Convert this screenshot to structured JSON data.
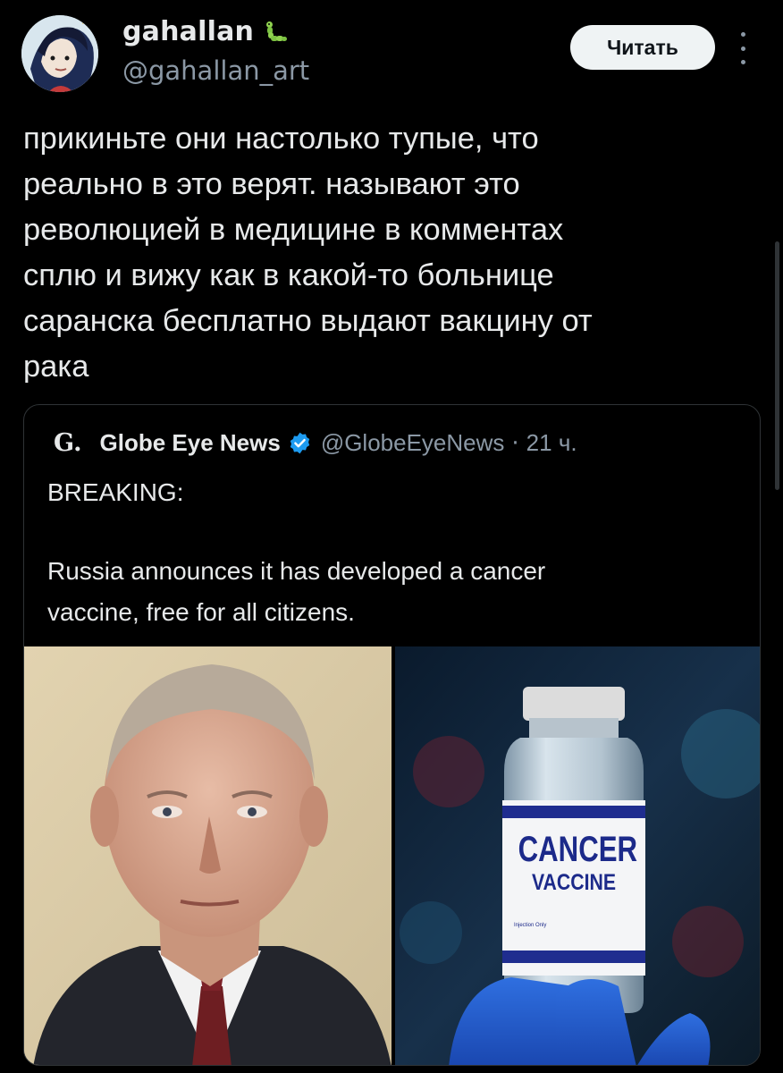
{
  "author": {
    "name": "gahallan",
    "handle": "@gahallan_art"
  },
  "header": {
    "follow_label": "Читать"
  },
  "post": {
    "text": "прикиньте они настолько тупые, что\nреально в это верят.  называют это\nреволюцией в медицине в комментах\nсплю и вижу как в какой-то больнице\nсаранска бесплатно  выдают вакцину от\nрака"
  },
  "quote": {
    "logo": "G.",
    "name": "Globe Eye News",
    "handle": "@GlobeEyeNews",
    "separator": "·",
    "time": "21 ч.",
    "breaking": "BREAKING:",
    "body": "Russia announces it has developed a cancer\nvaccine, free for all citizens.",
    "media_right": {
      "label_line1": "CANCER",
      "label_line2": "VACCINE",
      "label_small": "Injection Only"
    }
  },
  "colors": {
    "background": "#000000",
    "text_primary": "#e7e9ea",
    "text_secondary": "#8b98a5",
    "border": "#2f3336",
    "verified_blue": "#1d9bf0",
    "follow_bg": "#eff3f4"
  }
}
